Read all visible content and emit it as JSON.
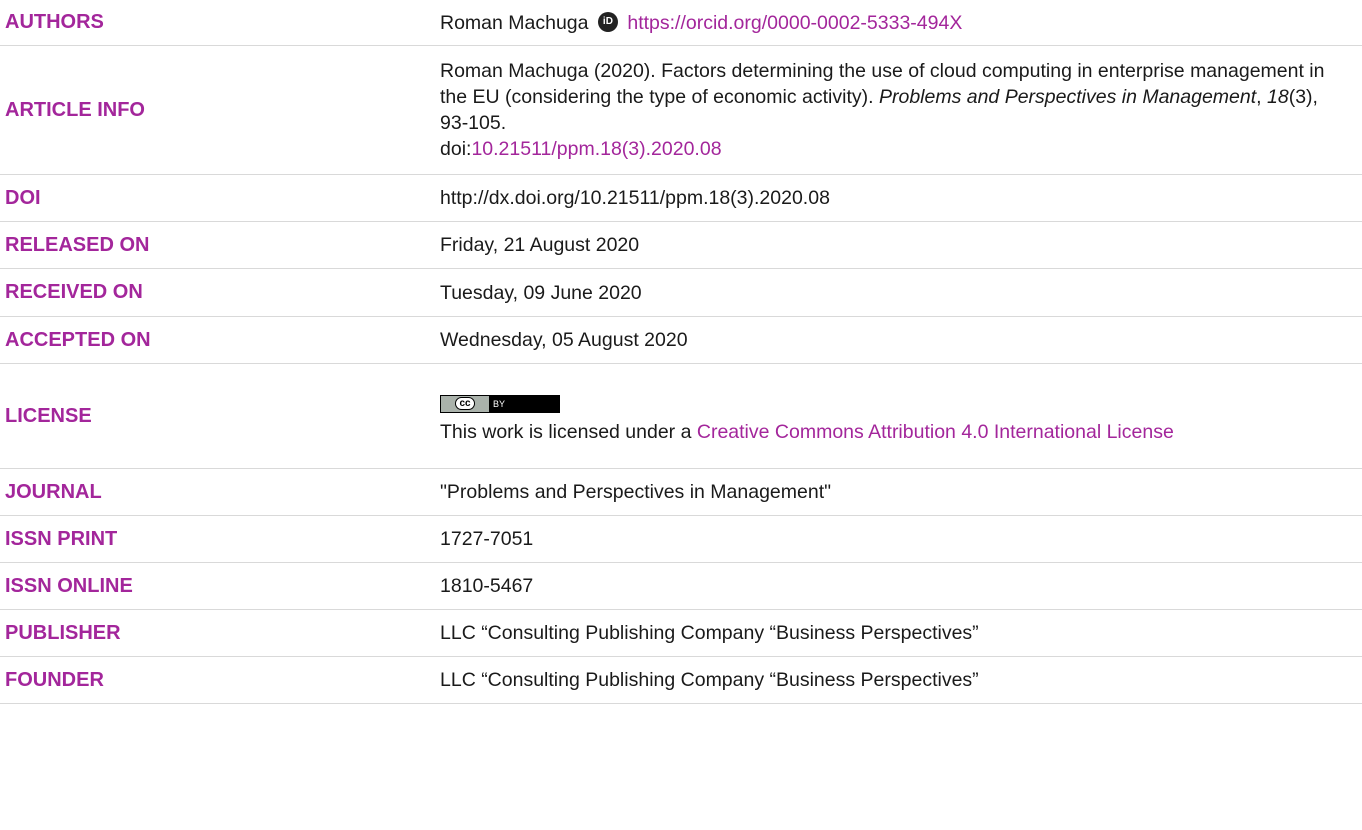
{
  "rows": {
    "authors": {
      "label": "AUTHORS",
      "name": "Roman Machuga",
      "orcid_icon": "orcid-icon",
      "orcid_url": "https://orcid.org/0000-0002-5333-494X"
    },
    "article_info": {
      "label": "ARTICLE INFO",
      "citation_main": "Roman Machuga (2020). Factors determining the use of cloud computing in enterprise management in the EU (considering the type of economic activity).",
      "journal_italic": "Problems and Perspectives in Management",
      "comma1": ",",
      "volume_italic": "18",
      "issue_pages": "(3), 93-105.",
      "doi_prefix": "doi:",
      "doi_link": "10.21511/ppm.18(3).2020.08"
    },
    "doi": {
      "label": "DOI",
      "value": "http://dx.doi.org/10.21511/ppm.18(3).2020.08"
    },
    "released_on": {
      "label": "RELEASED ON",
      "value": "Friday, 21 August 2020"
    },
    "received_on": {
      "label": "RECEIVED ON",
      "value": "Tuesday, 09 June 2020"
    },
    "accepted_on": {
      "label": "ACCEPTED ON",
      "value": "Wednesday, 05 August 2020"
    },
    "license": {
      "label": "LICENSE",
      "badge_left": "cc",
      "badge_right": "BY",
      "text_prefix": "This work is licensed under a",
      "link_text": "Creative Commons Attribution 4.0 International License"
    },
    "journal": {
      "label": "JOURNAL",
      "value": "\"Problems and Perspectives in Management\""
    },
    "issn_print": {
      "label": "ISSN PRINT",
      "value": "1727-7051"
    },
    "issn_online": {
      "label": "ISSN ONLINE",
      "value": "1810-5467"
    },
    "publisher": {
      "label": "PUBLISHER",
      "value": "LLC “Consulting Publishing Company “Business Perspectives”"
    },
    "founder": {
      "label": "FOUNDER",
      "value": "LLC “Consulting Publishing Company “Business Perspectives”"
    }
  },
  "colors": {
    "label": "#a3269b",
    "link": "#a3269b",
    "text": "#1a1a1a",
    "divider": "#d9d9d9"
  }
}
